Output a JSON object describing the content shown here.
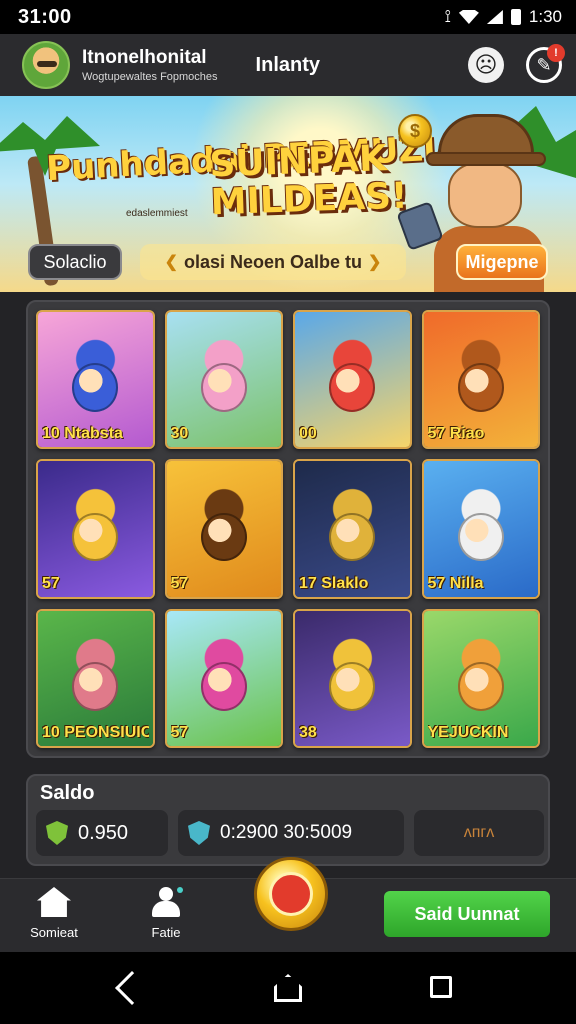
{
  "status_bar": {
    "time": "31:00",
    "right_text": "1:30"
  },
  "header": {
    "user_name": "Itnonelhonital",
    "user_sub": "Wogtupewaltes Fopmoches",
    "title": "Inlanty"
  },
  "banner": {
    "title_left": "Punhdadni PERMUZIA.",
    "caption": "edaslemmiest",
    "title_right": "SUINPAK MILDEAS!",
    "pill_left": "Solaclio",
    "marquee": "olasi Neoen Oalbe tu",
    "pill_right": "Migepne"
  },
  "games": [
    {
      "label": "10  Ntabsta",
      "theme": "pink"
    },
    {
      "label": "30",
      "theme": "meadow"
    },
    {
      "label": "00",
      "theme": "sky"
    },
    {
      "label": "57  Riao",
      "theme": "fire"
    },
    {
      "label": "57",
      "theme": "purple"
    },
    {
      "label": "57",
      "theme": "gold"
    },
    {
      "label": "17  Slaklo",
      "theme": "night"
    },
    {
      "label": "57  Nilla",
      "theme": "blue"
    },
    {
      "label": "10  PEONSIUIC",
      "theme": "jungle"
    },
    {
      "label": "57",
      "theme": "spring"
    },
    {
      "label": "38",
      "theme": "cart"
    },
    {
      "label": "YEJUCKIN",
      "theme": "green"
    }
  ],
  "saldo": {
    "title": "Saldo",
    "balance": "0.950",
    "account": "0:2900 30:5009",
    "extra": "ᴧᴨᴦᴧ"
  },
  "bottom_nav": {
    "home_label": "Somieat",
    "fave_label": "Fatie",
    "send_label": "Said Uunnat"
  },
  "colors": {
    "accent_orange": "#e9731c",
    "accent_green": "#2ea62a",
    "gold": "#ffd23d"
  }
}
